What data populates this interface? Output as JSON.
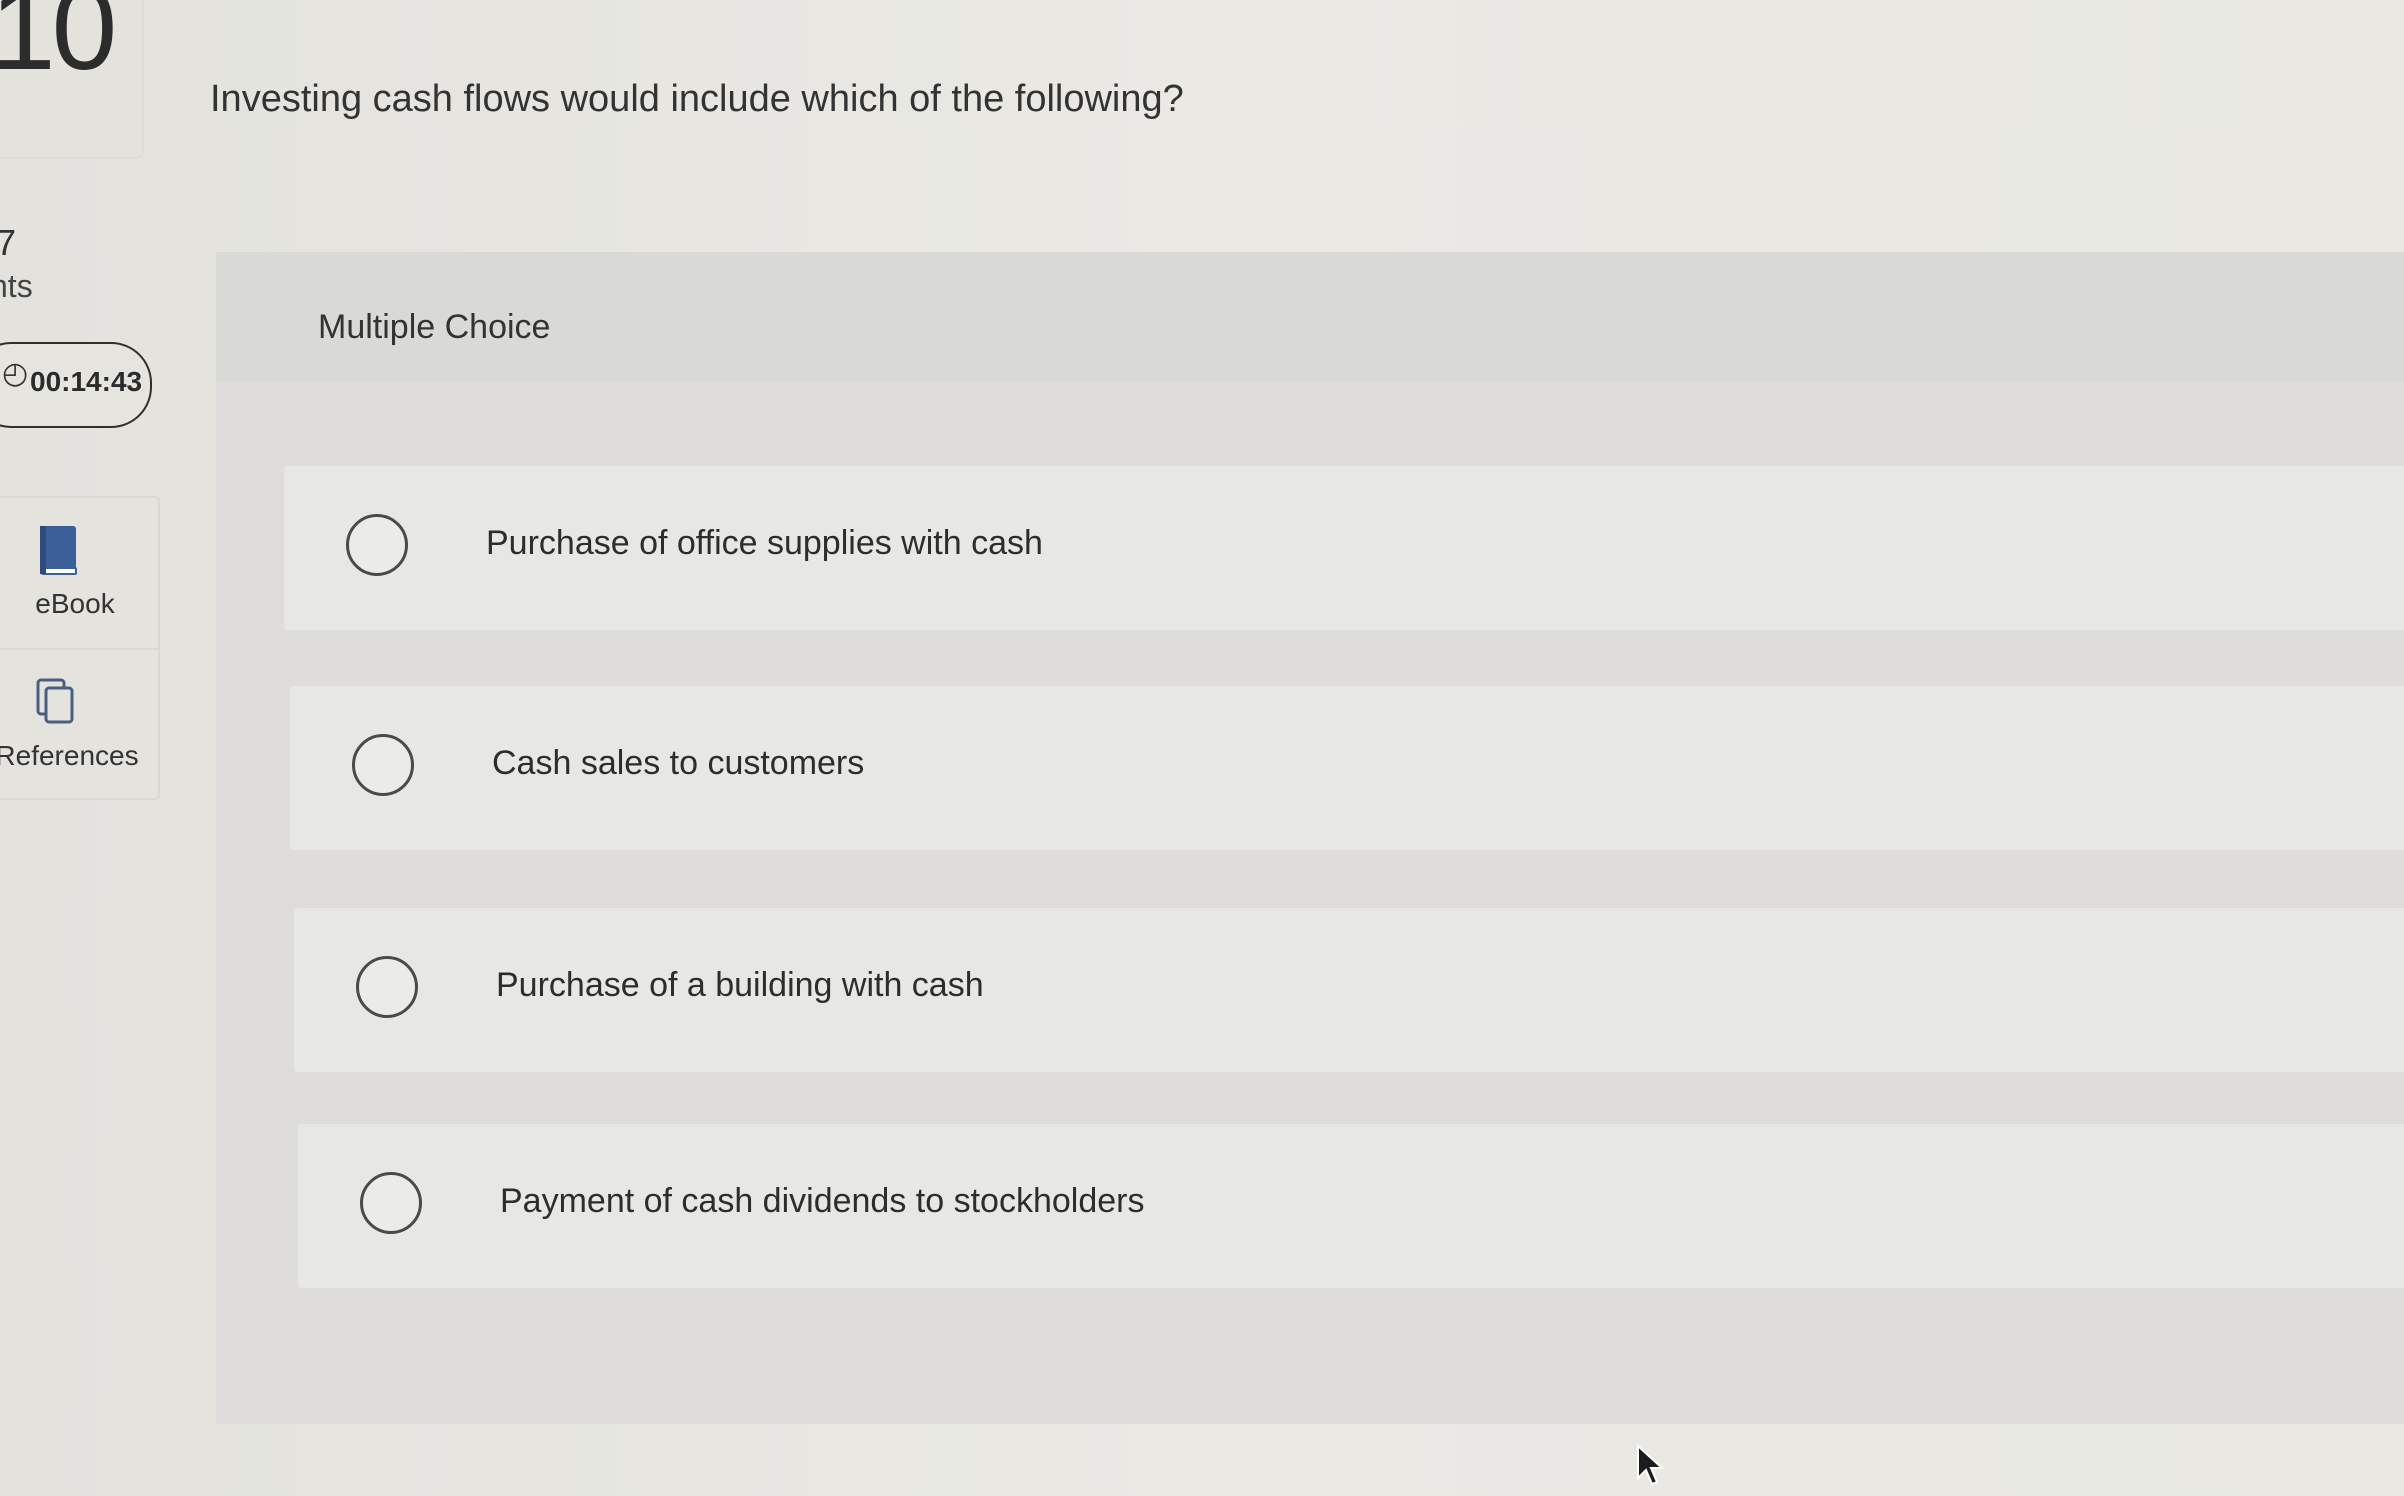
{
  "sidebar": {
    "question_number": "10",
    "points_value": "7",
    "points_label": "nts",
    "timer": "00:14:43",
    "tools": [
      {
        "label": "eBook",
        "icon": "book-icon"
      },
      {
        "label": "References",
        "icon": "documents-icon"
      }
    ]
  },
  "question": {
    "text": "Investing cash flows would include which of the following?"
  },
  "choices": {
    "header": "Multiple Choice",
    "options": [
      {
        "label": "Purchase of office supplies with cash",
        "selected": false
      },
      {
        "label": "Cash sales to customers",
        "selected": false
      },
      {
        "label": "Purchase of a building with cash",
        "selected": false
      },
      {
        "label": "Payment of cash dividends to stockholders",
        "selected": false
      }
    ]
  },
  "colors": {
    "background": "#e7e6e1",
    "card": "#dedddb",
    "option_bg": "#e7e7e4",
    "ebook_icon": "#3d5f99",
    "text": "#2f2f2f"
  }
}
